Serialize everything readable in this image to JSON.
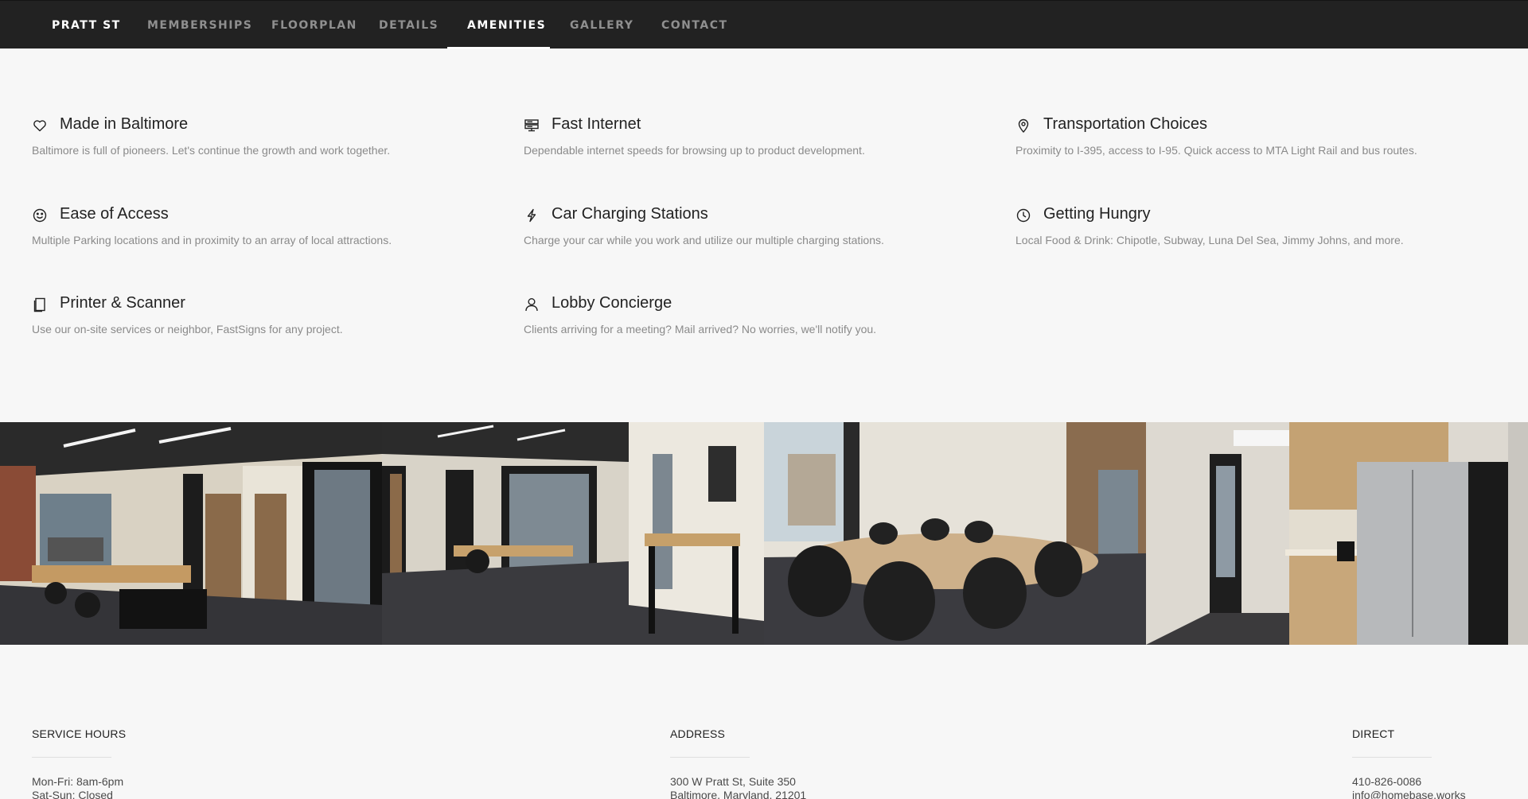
{
  "nav": {
    "brand": "PRATT ST",
    "items": [
      {
        "label": "MEMBERSHIPS"
      },
      {
        "label": "FLOORPLAN"
      },
      {
        "label": "DETAILS"
      },
      {
        "label": "AMENITIES"
      },
      {
        "label": "GALLERY"
      },
      {
        "label": "CONTACT"
      }
    ],
    "active": "AMENITIES"
  },
  "amenities": [
    {
      "icon": "heart-icon",
      "title": "Made in Baltimore",
      "description": "Baltimore is full of pioneers. Let's continue the growth and work together."
    },
    {
      "icon": "server-icon",
      "title": "Fast Internet",
      "description": "Dependable internet speeds for browsing up to product development."
    },
    {
      "icon": "map-pin-icon",
      "title": "Transportation Choices",
      "description": "Proximity to I-395, access to I-95. Quick access to MTA Light Rail and bus routes."
    },
    {
      "icon": "smile-icon",
      "title": "Ease of Access",
      "description": "Multiple Parking locations and in proximity to an array of local attractions."
    },
    {
      "icon": "lightning-icon",
      "title": "Car Charging Stations",
      "description": "Charge your car while you work and utilize our multiple charging stations."
    },
    {
      "icon": "clock-icon",
      "title": "Getting Hungry",
      "description": "Local Food & Drink: Chipotle, Subway, Luna Del Sea, Jimmy Johns, and more."
    },
    {
      "icon": "copy-icon",
      "title": "Printer & Scanner",
      "description": "Use our on-site services or neighbor, FastSigns for any project."
    },
    {
      "icon": "user-icon",
      "title": "Lobby Concierge",
      "description": "Clients arriving for a meeting? Mail arrived? No worries, we'll notify you."
    }
  ],
  "gallery": {
    "photos": [
      {
        "subject": "open-office-desks"
      },
      {
        "subject": "hallway-high-table"
      },
      {
        "subject": "conference-room"
      },
      {
        "subject": "kitchen"
      }
    ]
  },
  "footer": {
    "service_hours": {
      "heading": "SERVICE HOURS",
      "lines": [
        "Mon-Fri: 8am-6pm",
        "Sat-Sun: Closed"
      ]
    },
    "address": {
      "heading": "ADDRESS",
      "lines": [
        "300 W Pratt St, Suite 350",
        "Baltimore, Maryland, 21201"
      ]
    },
    "direct": {
      "heading": "DIRECT",
      "lines": [
        "410-826-0086",
        "info@homebase.works"
      ]
    }
  },
  "colors": {
    "nav_background": "#222222",
    "page_background": "#f7f7f7",
    "nav_text_inactive": "#8f8f8f",
    "nav_text_active": "#ffffff",
    "description_text": "#8a8a8a"
  }
}
